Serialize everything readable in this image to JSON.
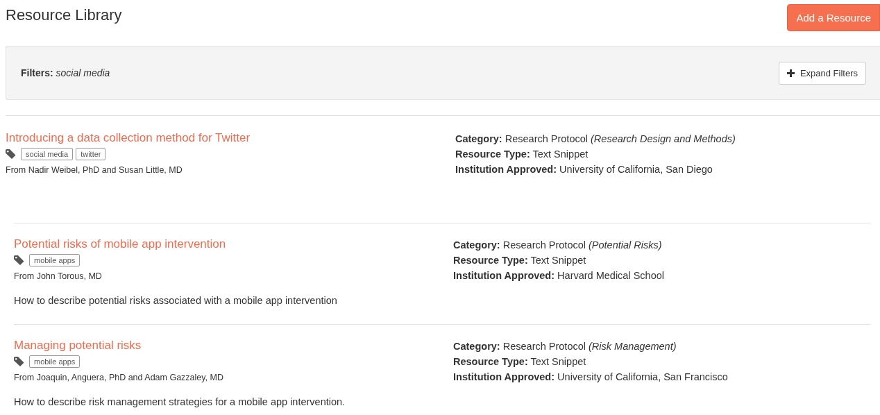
{
  "page_title": "Resource Library",
  "add_button": "Add a Resource",
  "filters": {
    "text": "**Filters:** *social media*",
    "expand_button": "Expand Filters"
  },
  "result_groups": [
    {
      "resources": [
        {
          "title": "Introducing a data collection method for Twitter",
          "tags": [
            "social media",
            "twitter"
          ],
          "author": "From Nadir Weibel, PhD and Susan Little, MD",
          "details": [
            "**Category:** Research Protocol *(Research Design and Methods)*",
            "**Resource Type:** Text Snippet",
            "**Institution Approved:** University of California, San Diego"
          ]
        }
      ]
    },
    {
      "resources": [
        {
          "title": "Potential risks of mobile app intervention",
          "tags": [
            "mobile apps"
          ],
          "author": "From John Torous, MD",
          "description": "How to describe potential risks associated with a mobile app intervention",
          "details": [
            "**Category:** Research Protocol *(Potential Risks)*",
            "**Resource Type:** Text Snippet",
            "**Institution Approved:** Harvard Medical School"
          ]
        },
        {
          "title": "Managing potential risks",
          "tags": [
            "mobile apps"
          ],
          "author": "From Joaquin, Anguera, PhD and Adam Gazzaley, MD",
          "description": "How to describe risk management strategies for a mobile app intervention.",
          "details": [
            "**Category:** Research Protocol *(Risk Management)*",
            "**Resource Type:** Text Snippet",
            "**Institution Approved:** University of California, San Francisco"
          ]
        }
      ]
    }
  ]
}
